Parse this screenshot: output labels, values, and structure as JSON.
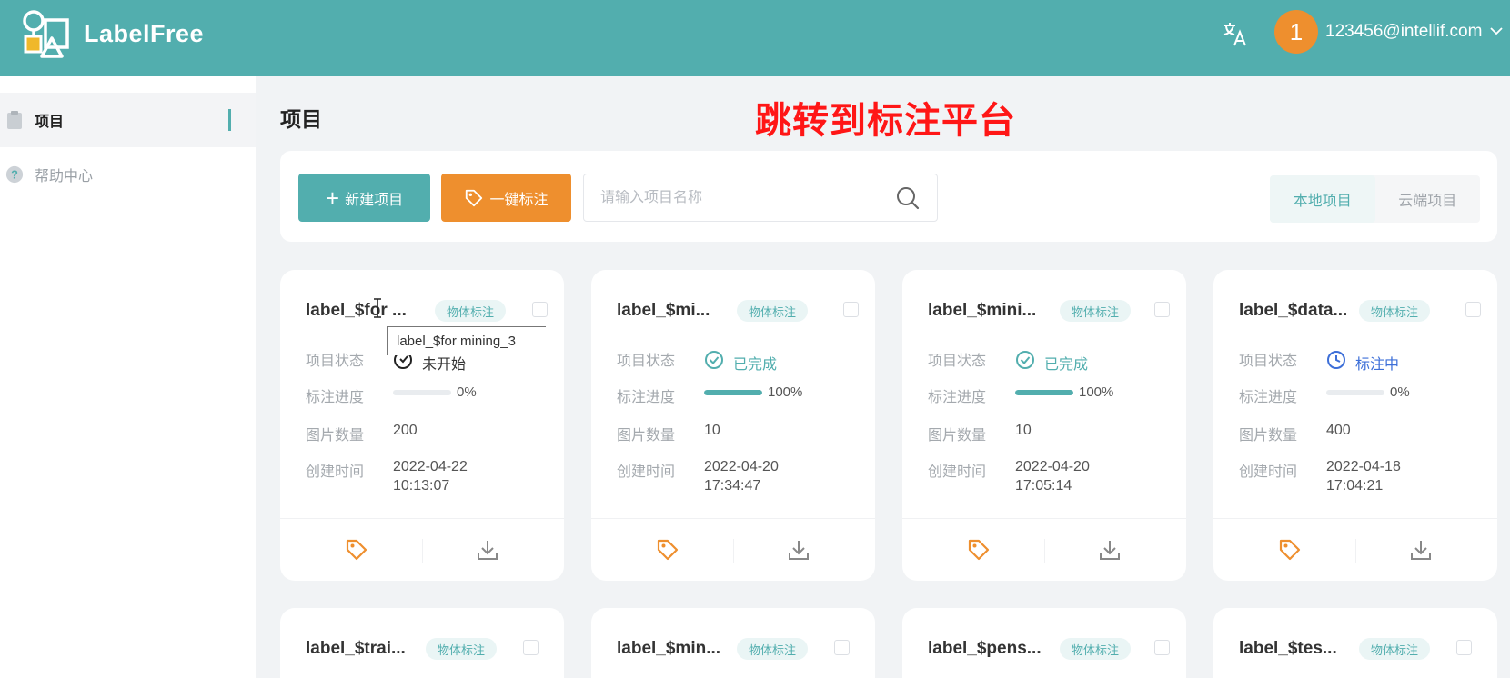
{
  "header": {
    "app_name": "LabelFree",
    "user_avatar_text": "1",
    "user_email": "123456@intellif.com",
    "colors": {
      "primary": "#52aeae",
      "accent": "#ee8f2e"
    }
  },
  "sidebar": {
    "items": [
      {
        "label": "项目",
        "icon": "clipboard-icon",
        "active": true
      },
      {
        "label": "帮助中心",
        "icon": "help-circle-icon",
        "active": false
      }
    ]
  },
  "main": {
    "page_title": "项目",
    "annotation_note": "跳转到标注平台",
    "toolbar": {
      "new_project_label": "新建项目",
      "one_click_label": "一键标注",
      "search_placeholder": "请输入项目名称",
      "tabs": [
        "本地项目",
        "云端项目"
      ]
    },
    "field_labels": {
      "status": "项目状态",
      "progress": "标注进度",
      "image_count": "图片数量",
      "created": "创建时间"
    },
    "cards": [
      {
        "title": "label_$for ...",
        "tag": "物体标注",
        "status": "未开始",
        "status_type": "todo",
        "progress_text": "0%",
        "progress": 0,
        "image_count": "200",
        "date": "2022-04-22",
        "time": "10:13:07"
      },
      {
        "title": "label_$mi...",
        "tag": "物体标注",
        "status": "已完成",
        "status_type": "done",
        "progress_text": "100%",
        "progress": 1,
        "image_count": "10",
        "date": "2022-04-20",
        "time": "17:34:47"
      },
      {
        "title": "label_$mini...",
        "tag": "物体标注",
        "status": "已完成",
        "status_type": "done",
        "progress_text": "100%",
        "progress": 1,
        "image_count": "10",
        "date": "2022-04-20",
        "time": "17:05:14"
      },
      {
        "title": "label_$data...",
        "tag": "物体标注",
        "status": "标注中",
        "status_type": "doing",
        "progress_text": "0%",
        "progress": 0,
        "image_count": "400",
        "date": "2022-04-18",
        "time": "17:04:21"
      }
    ],
    "cards_row2": [
      {
        "title": "label_$trai...",
        "tag": "物体标注"
      },
      {
        "title": "label_$min...",
        "tag": "物体标注"
      },
      {
        "title": "label_$pens...",
        "tag": "物体标注"
      },
      {
        "title": "label_$tes...",
        "tag": "物体标注"
      }
    ],
    "tooltip": "label_$for mining_3"
  }
}
